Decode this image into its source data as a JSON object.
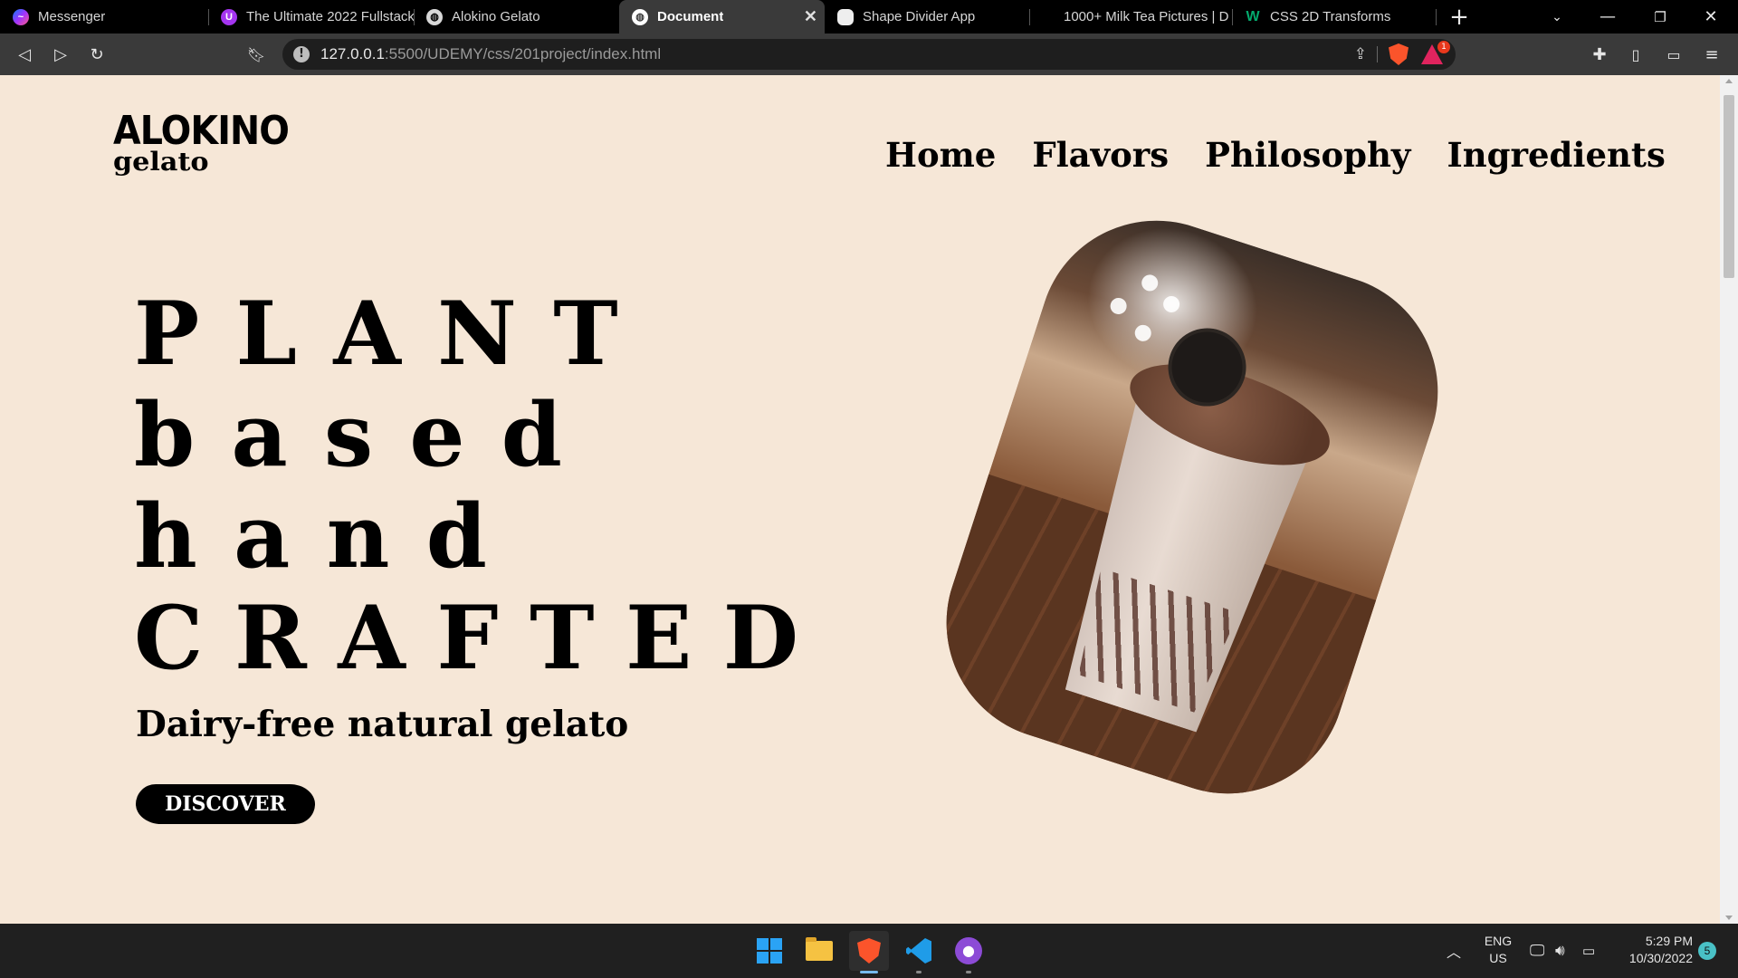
{
  "browser": {
    "tabs": [
      {
        "title": "Messenger",
        "icon": "messenger-icon",
        "color": "#7b5cff"
      },
      {
        "title": "The Ultimate 2022 Fullstack",
        "icon": "udemy-icon",
        "color": "#a435f0"
      },
      {
        "title": "Alokino Gelato",
        "icon": "globe-icon",
        "color": "#cccccc"
      },
      {
        "title": "Document",
        "icon": "globe-icon",
        "color": "#ffffff",
        "active": true
      },
      {
        "title": "Shape Divider App",
        "icon": "shape-icon",
        "color": "#ffffff"
      },
      {
        "title": "1000+ Milk Tea Pictures | D",
        "icon": "",
        "color": ""
      },
      {
        "title": "CSS 2D Transforms",
        "icon": "w3schools-icon",
        "color": "#04aa6d"
      }
    ],
    "new_tab": "+",
    "url_host": "127.0.0.1",
    "url_path": ":5500/UDEMY/css/201project/index.html",
    "rewards_badge": "1"
  },
  "page": {
    "logo": {
      "line1": "ALOKINO",
      "line2": "gelato"
    },
    "nav": [
      "Home",
      "Flavors",
      "Philosophy",
      "Ingredients"
    ],
    "hero_lines": [
      "PLANT",
      "based",
      "hand",
      "CRAFTED"
    ],
    "subtitle": "Dairy-free natural gelato",
    "cta": "DISCOVER",
    "background": "#f6e7d7"
  },
  "taskbar": {
    "lang_line1": "ENG",
    "lang_line2": "US",
    "time": "5:29 PM",
    "date": "10/30/2022",
    "notifications": "5"
  }
}
